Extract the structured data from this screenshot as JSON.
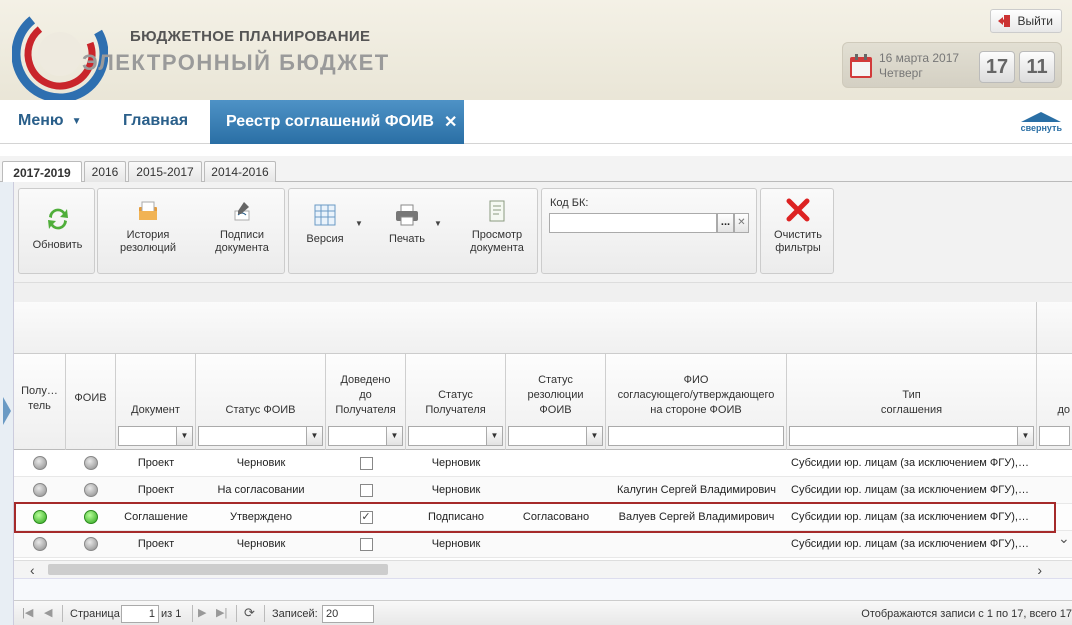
{
  "header": {
    "brand_top": "БЮДЖЕТНОЕ ПЛАНИРОВАНИЕ",
    "brand_main": "ЭЛЕКТРОННЫЙ БЮДЖЕТ",
    "logout_label": "Выйти",
    "date": "16 марта 2017",
    "weekday": "Четверг",
    "hour": "17",
    "minute": "11"
  },
  "nav": {
    "menu": "Меню",
    "home": "Главная",
    "active_tab": "Реестр соглашений ФОИВ",
    "collapse": "свернуть"
  },
  "year_tabs": [
    "2017-2019",
    "2016",
    "2015-2017",
    "2014-2016"
  ],
  "toolbar": {
    "refresh": "Обновить",
    "history_l1": "История",
    "history_l2": "резолюций",
    "signatures_l1": "Подписи",
    "signatures_l2": "документа",
    "version": "Версия",
    "print": "Печать",
    "view_l1": "Просмотр",
    "view_l2": "документа",
    "kod_bk_label": "Код БК:",
    "kod_bk_value": "",
    "clear_l1": "Очистить",
    "clear_l2": "фильтры",
    "dots": "..."
  },
  "columns": [
    {
      "l1": "Полу…",
      "l2": "тель",
      "l3": ""
    },
    {
      "l1": "ФОИВ",
      "l2": "",
      "l3": ""
    },
    {
      "l1": "Документ",
      "l2": "",
      "l3": ""
    },
    {
      "l1": "Статус ФОИВ",
      "l2": "",
      "l3": ""
    },
    {
      "l1": "Доведено",
      "l2": "до",
      "l3": "Получателя"
    },
    {
      "l1": "Статус",
      "l2": "Получателя",
      "l3": ""
    },
    {
      "l1": "Статус",
      "l2": "резолюции",
      "l3": "ФОИВ"
    },
    {
      "l1": "ФИО",
      "l2": "согласующего/утверждающего",
      "l3": "на стороне ФОИВ"
    },
    {
      "l1": "Тип",
      "l2": "соглашения",
      "l3": ""
    },
    {
      "l1": "до",
      "l2": "",
      "l3": ""
    }
  ],
  "rows": [
    {
      "recipient": "grey",
      "foiv": "grey",
      "document": "Проект",
      "status_foiv": "Черновик",
      "delivered": false,
      "status_recipient": "Черновик",
      "resolution": "",
      "fio": "",
      "type": "Субсидии юр. лицам (за исключением ФГУ),…"
    },
    {
      "recipient": "grey",
      "foiv": "grey",
      "document": "Проект",
      "status_foiv": "На согласовании",
      "delivered": false,
      "status_recipient": "Черновик",
      "resolution": "",
      "fio": "Калугин Сергей Владимирович",
      "type": "Субсидии юр. лицам (за исключением ФГУ),…"
    },
    {
      "recipient": "green",
      "foiv": "green",
      "document": "Соглашение",
      "status_foiv": "Утверждено",
      "delivered": true,
      "status_recipient": "Подписано",
      "resolution": "Согласовано",
      "fio": "Валуев Сергей Владимирович",
      "type": "Субсидии юр. лицам (за исключением ФГУ),…"
    },
    {
      "recipient": "grey",
      "foiv": "grey",
      "document": "Проект",
      "status_foiv": "Черновик",
      "delivered": false,
      "status_recipient": "Черновик",
      "resolution": "",
      "fio": "",
      "type": "Субсидии юр. лицам (за исключением ФГУ),…"
    }
  ],
  "pager": {
    "page_label": "Страница",
    "page_value": "1",
    "of_label": "из 1",
    "records_label": "Записей:",
    "records_value": "20",
    "summary": "Отображаются записи с 1 по 17, всего 17"
  },
  "colors": {
    "brand_blue": "#2a6fa5",
    "selection_outline": "#a52a2a"
  }
}
